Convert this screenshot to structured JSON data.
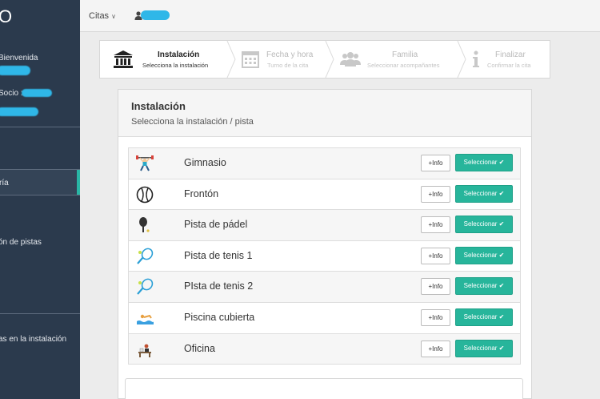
{
  "sidebar": {
    "brand": "O",
    "welcome": "Bienvenida",
    "socio_label": "Socio :",
    "items": [
      {
        "label": "ría"
      },
      {
        "label": "ón de pistas"
      },
      {
        "label": "as en la instalación"
      }
    ]
  },
  "topbar": {
    "menu_label": "Citas",
    "menu_caret": "∨"
  },
  "wizard": {
    "steps": [
      {
        "title": "Instalación",
        "subtitle": "Selecciona la instalación",
        "icon": "building-icon"
      },
      {
        "title": "Fecha y hora",
        "subtitle": "Turno de la cita",
        "icon": "calendar-icon"
      },
      {
        "title": "Familia",
        "subtitle": "Seleccionar acompañantes",
        "icon": "group-icon"
      },
      {
        "title": "Finalizar",
        "subtitle": "Confirmar la cita",
        "icon": "info-icon"
      }
    ]
  },
  "panel": {
    "title": "Instalación",
    "subtitle": "Selecciona la instalación / pista"
  },
  "facilities": [
    {
      "name": "Gimnasio",
      "icon": "weightlifter-icon"
    },
    {
      "name": "Frontón",
      "icon": "ball-icon"
    },
    {
      "name": "Pista de pádel",
      "icon": "paddle-icon"
    },
    {
      "name": "Pista de tenis 1",
      "icon": "tennis-racket-icon"
    },
    {
      "name": "PIsta de tenis 2",
      "icon": "tennis-racket-icon"
    },
    {
      "name": "Piscina cubierta",
      "icon": "swimmer-icon"
    },
    {
      "name": "Oficina",
      "icon": "office-icon"
    }
  ],
  "buttons": {
    "info": "+Info",
    "select": "Seleccionar ✔"
  },
  "colors": {
    "sidebar": "#2b3a4d",
    "accent": "#27b59b",
    "redacted": "#2fb7e8"
  }
}
